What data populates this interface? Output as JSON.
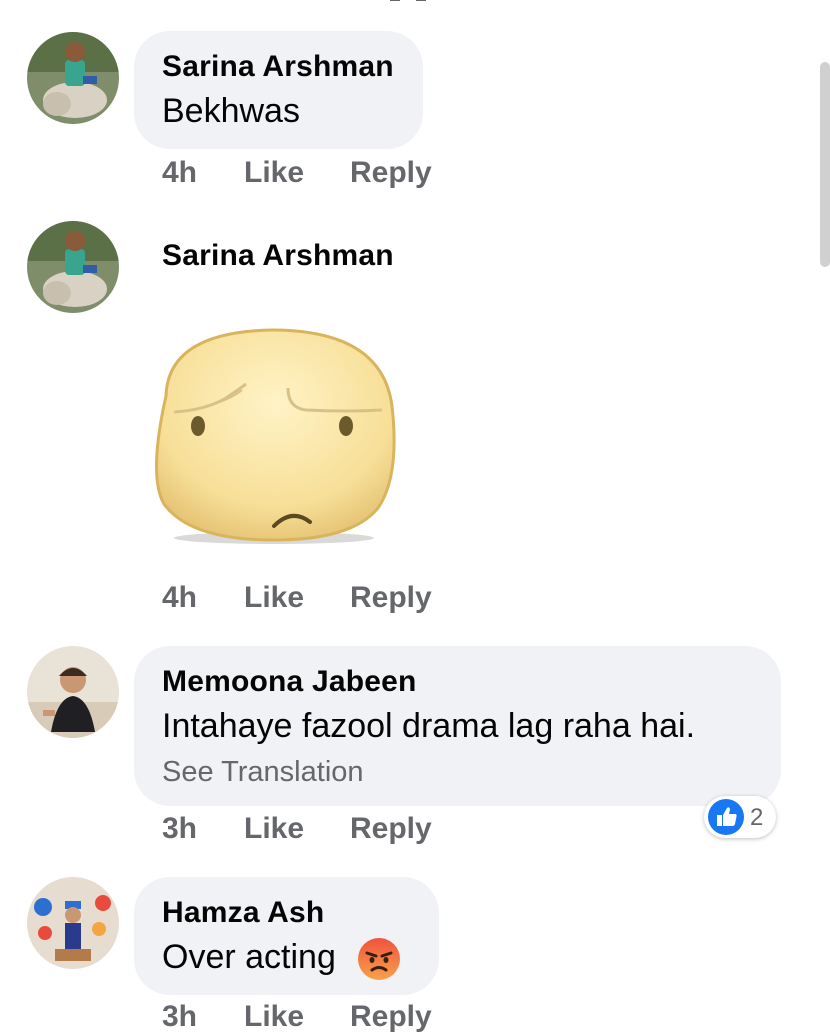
{
  "comments": [
    {
      "author": "Sarina Arshman",
      "text": "Bekhwas",
      "time": "4h",
      "like_label": "Like",
      "reply_label": "Reply",
      "avatar_icon": "profile-photo-person-riding-animal"
    },
    {
      "author": "Sarina Arshman",
      "sticker_icon": "worried-face-sticker",
      "time": "4h",
      "like_label": "Like",
      "reply_label": "Reply",
      "avatar_icon": "profile-photo-person-riding-animal"
    },
    {
      "author": "Memoona Jabeen",
      "text": "Intahaye fazool drama lag raha hai.",
      "see_translation": "See Translation",
      "time": "3h",
      "like_label": "Like",
      "reply_label": "Reply",
      "reaction": {
        "icon": "like-icon",
        "count": "2"
      },
      "avatar_icon": "profile-photo-child"
    },
    {
      "author": "Hamza Ash",
      "text": "Over acting",
      "emoji_icon": "angry-face-emoji",
      "time": "3h",
      "like_label": "Like",
      "reply_label": "Reply",
      "avatar_icon": "profile-photo-child-party"
    }
  ],
  "colors": {
    "bubble": "#f0f2f5",
    "meta_text": "#65676b",
    "like_blue": "#1877f2"
  }
}
